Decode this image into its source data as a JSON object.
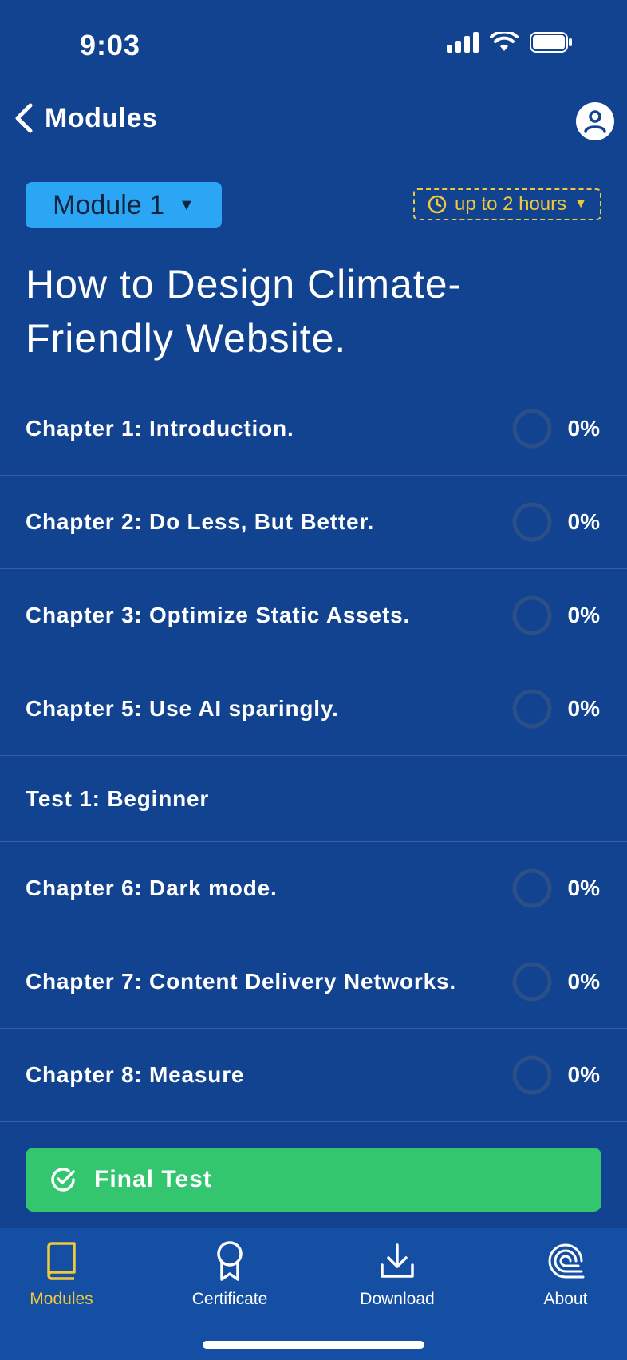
{
  "status_bar": {
    "time": "9:03"
  },
  "nav": {
    "back_label": "Modules"
  },
  "module_selector": {
    "label": "Module 1"
  },
  "duration": {
    "label": "up to 2 hours"
  },
  "title": "How to Design Climate-Friendly Website.",
  "chapters": [
    {
      "label": "Chapter 1: Introduction.",
      "progress": "0%"
    },
    {
      "label": "Chapter 2: Do Less, But Better.",
      "progress": "0%"
    },
    {
      "label": "Chapter 3: Optimize Static Assets.",
      "progress": "0%"
    },
    {
      "label": "Chapter 5: Use AI sparingly.",
      "progress": "0%"
    },
    {
      "label": "Test 1: Beginner"
    },
    {
      "label": "Chapter 6: Dark mode.",
      "progress": "0%"
    },
    {
      "label": "Chapter 7: Content Delivery Networks.",
      "progress": "0%"
    },
    {
      "label": "Chapter 8: Measure",
      "progress": "0%"
    }
  ],
  "final_test": {
    "label": "Final Test"
  },
  "tabs": [
    {
      "label": "Modules",
      "icon": "book-icon",
      "active": true
    },
    {
      "label": "Certificate",
      "icon": "award-icon"
    },
    {
      "label": "Download",
      "icon": "download-icon"
    },
    {
      "label": "About",
      "icon": "spiral-logo-icon"
    }
  ],
  "colors": {
    "background": "#124391",
    "module_button": "#2ba6f5",
    "duration_accent": "#f0c93b",
    "final_test_button": "#34c66f",
    "active_tab": "#f0c93b",
    "tab_bar": "#154fa3"
  }
}
